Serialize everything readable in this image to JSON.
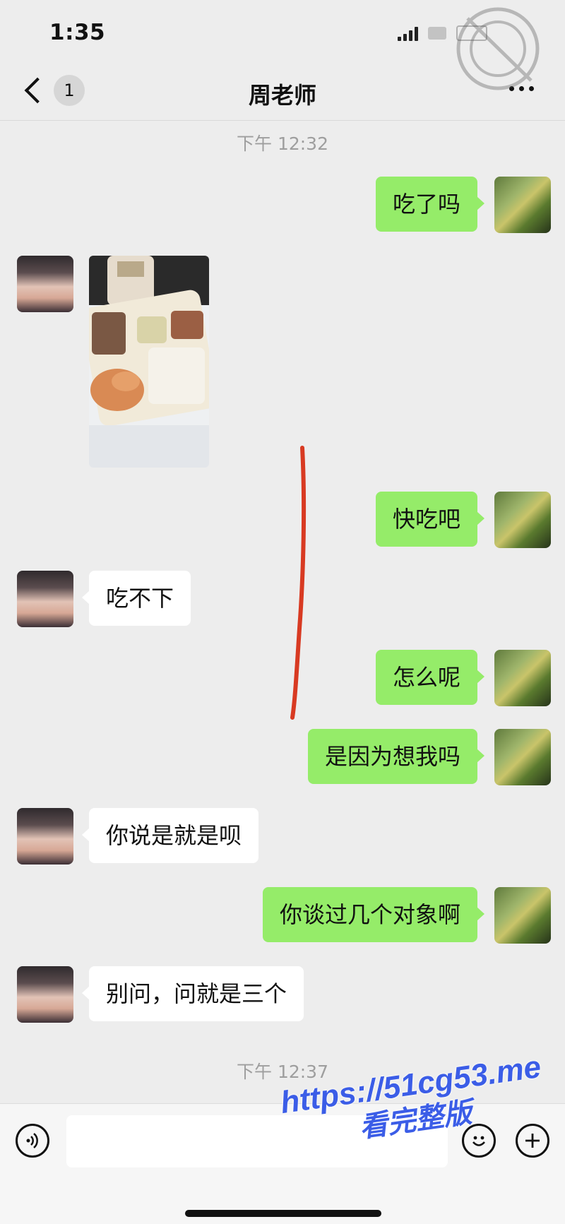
{
  "status_bar": {
    "time": "1:35"
  },
  "header": {
    "back_badge": "1",
    "title": "周老师"
  },
  "timestamps": [
    "下午 12:32",
    "下午 12:37"
  ],
  "messages": [
    {
      "sender": "me",
      "text": "吃了吗"
    },
    {
      "sender": "her",
      "type": "image",
      "image_name": "food-photo"
    },
    {
      "sender": "me",
      "text": "快吃吧"
    },
    {
      "sender": "her",
      "text": "吃不下"
    },
    {
      "sender": "me",
      "text": "怎么呢"
    },
    {
      "sender": "me",
      "text": "是因为想我吗"
    },
    {
      "sender": "her",
      "text": "你说是就是呗"
    },
    {
      "sender": "me",
      "text": "你谈过几个对象啊"
    },
    {
      "sender": "her",
      "text": "别问，问就是三个"
    }
  ],
  "input_bar": {
    "value": ""
  },
  "watermark": {
    "url": "https://51cg53.me",
    "text": "看完整版"
  },
  "colors": {
    "my_bubble": "#95ec69",
    "her_bubble": "#ffffff",
    "background": "#ededed",
    "annotation": "#d83a22",
    "watermark": "#3b5de7"
  }
}
